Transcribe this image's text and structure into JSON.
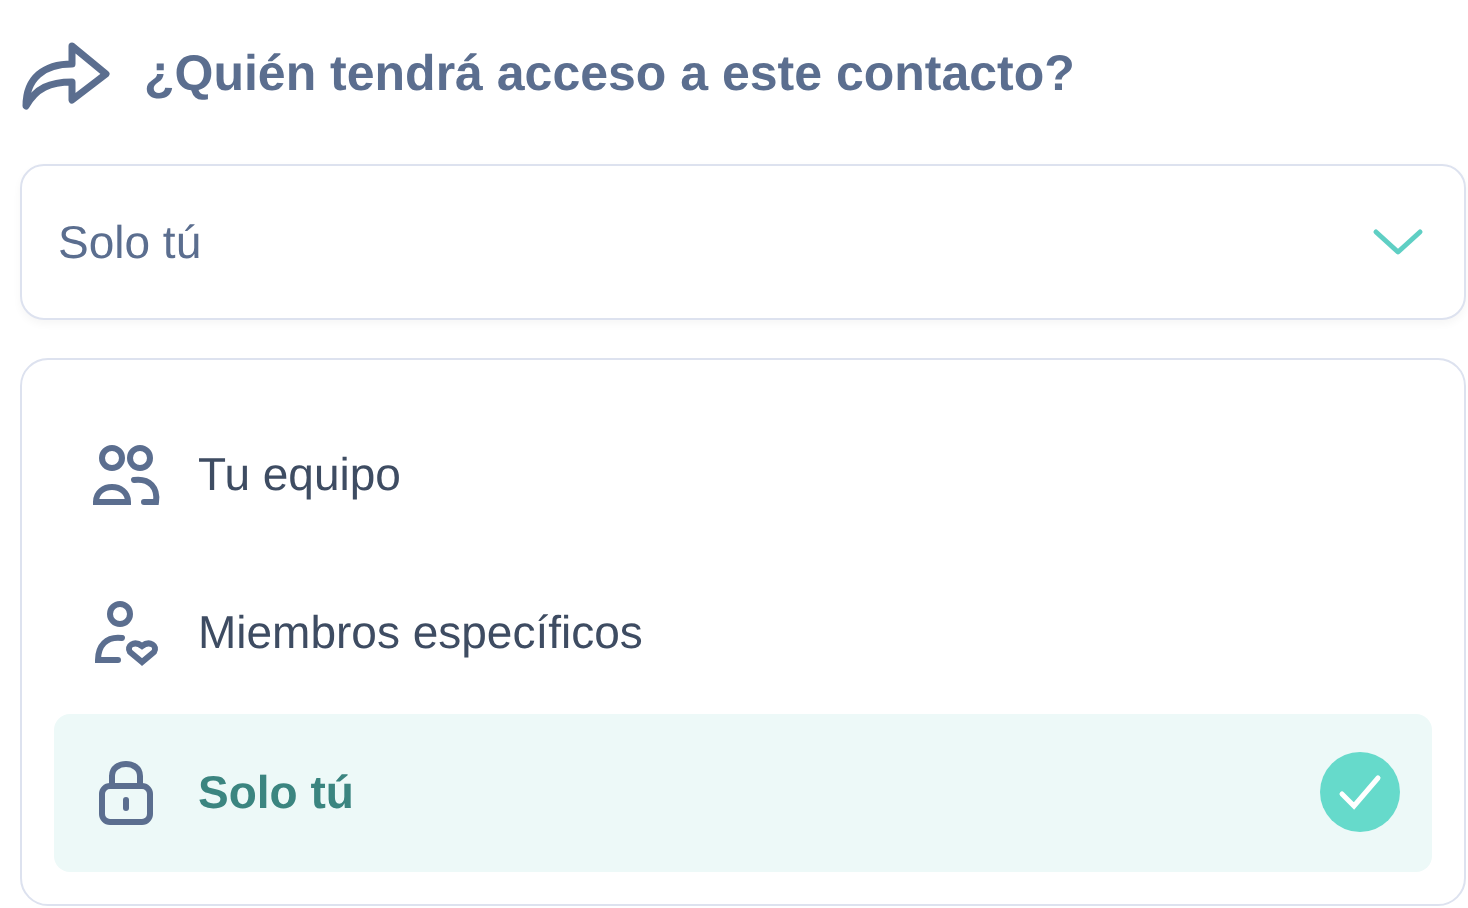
{
  "heading": "¿Quién tendrá acceso a este contacto?",
  "select": {
    "value": "Solo tú"
  },
  "options": [
    {
      "kind": "team",
      "label": "Tu equipo",
      "selected": false
    },
    {
      "kind": "member",
      "label": "Miembros específicos",
      "selected": false
    },
    {
      "kind": "lock",
      "label": "Solo tú",
      "selected": true
    }
  ]
}
